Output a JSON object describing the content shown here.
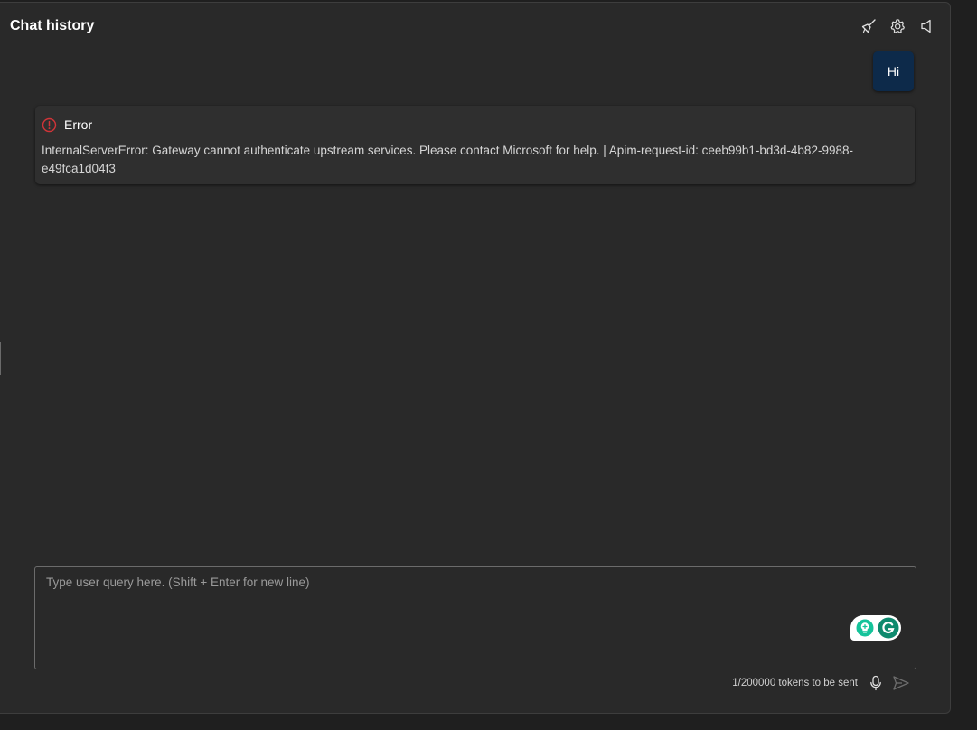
{
  "header": {
    "title": "Chat history"
  },
  "toolbar_icons": [
    "broom-icon",
    "gear-icon",
    "speaker-icon"
  ],
  "messages": {
    "user": {
      "text": "Hi"
    },
    "error": {
      "title": "Error",
      "message": "InternalServerError: Gateway cannot authenticate upstream services. Please contact Microsoft for help. | Apim-request-id: ceeb99b1-bd3d-4b82-9988-e49fca1d04f3"
    }
  },
  "input": {
    "value": "",
    "placeholder": "Type user query here. (Shift + Enter for new line)"
  },
  "footer": {
    "token_count": "1/200000 tokens to be sent"
  },
  "colors": {
    "user_bubble": "#0d2a4a",
    "error_icon": "#d13438",
    "grammarly_green": "#15c39a",
    "grammarly_dark_green": "#0e8a6e"
  }
}
